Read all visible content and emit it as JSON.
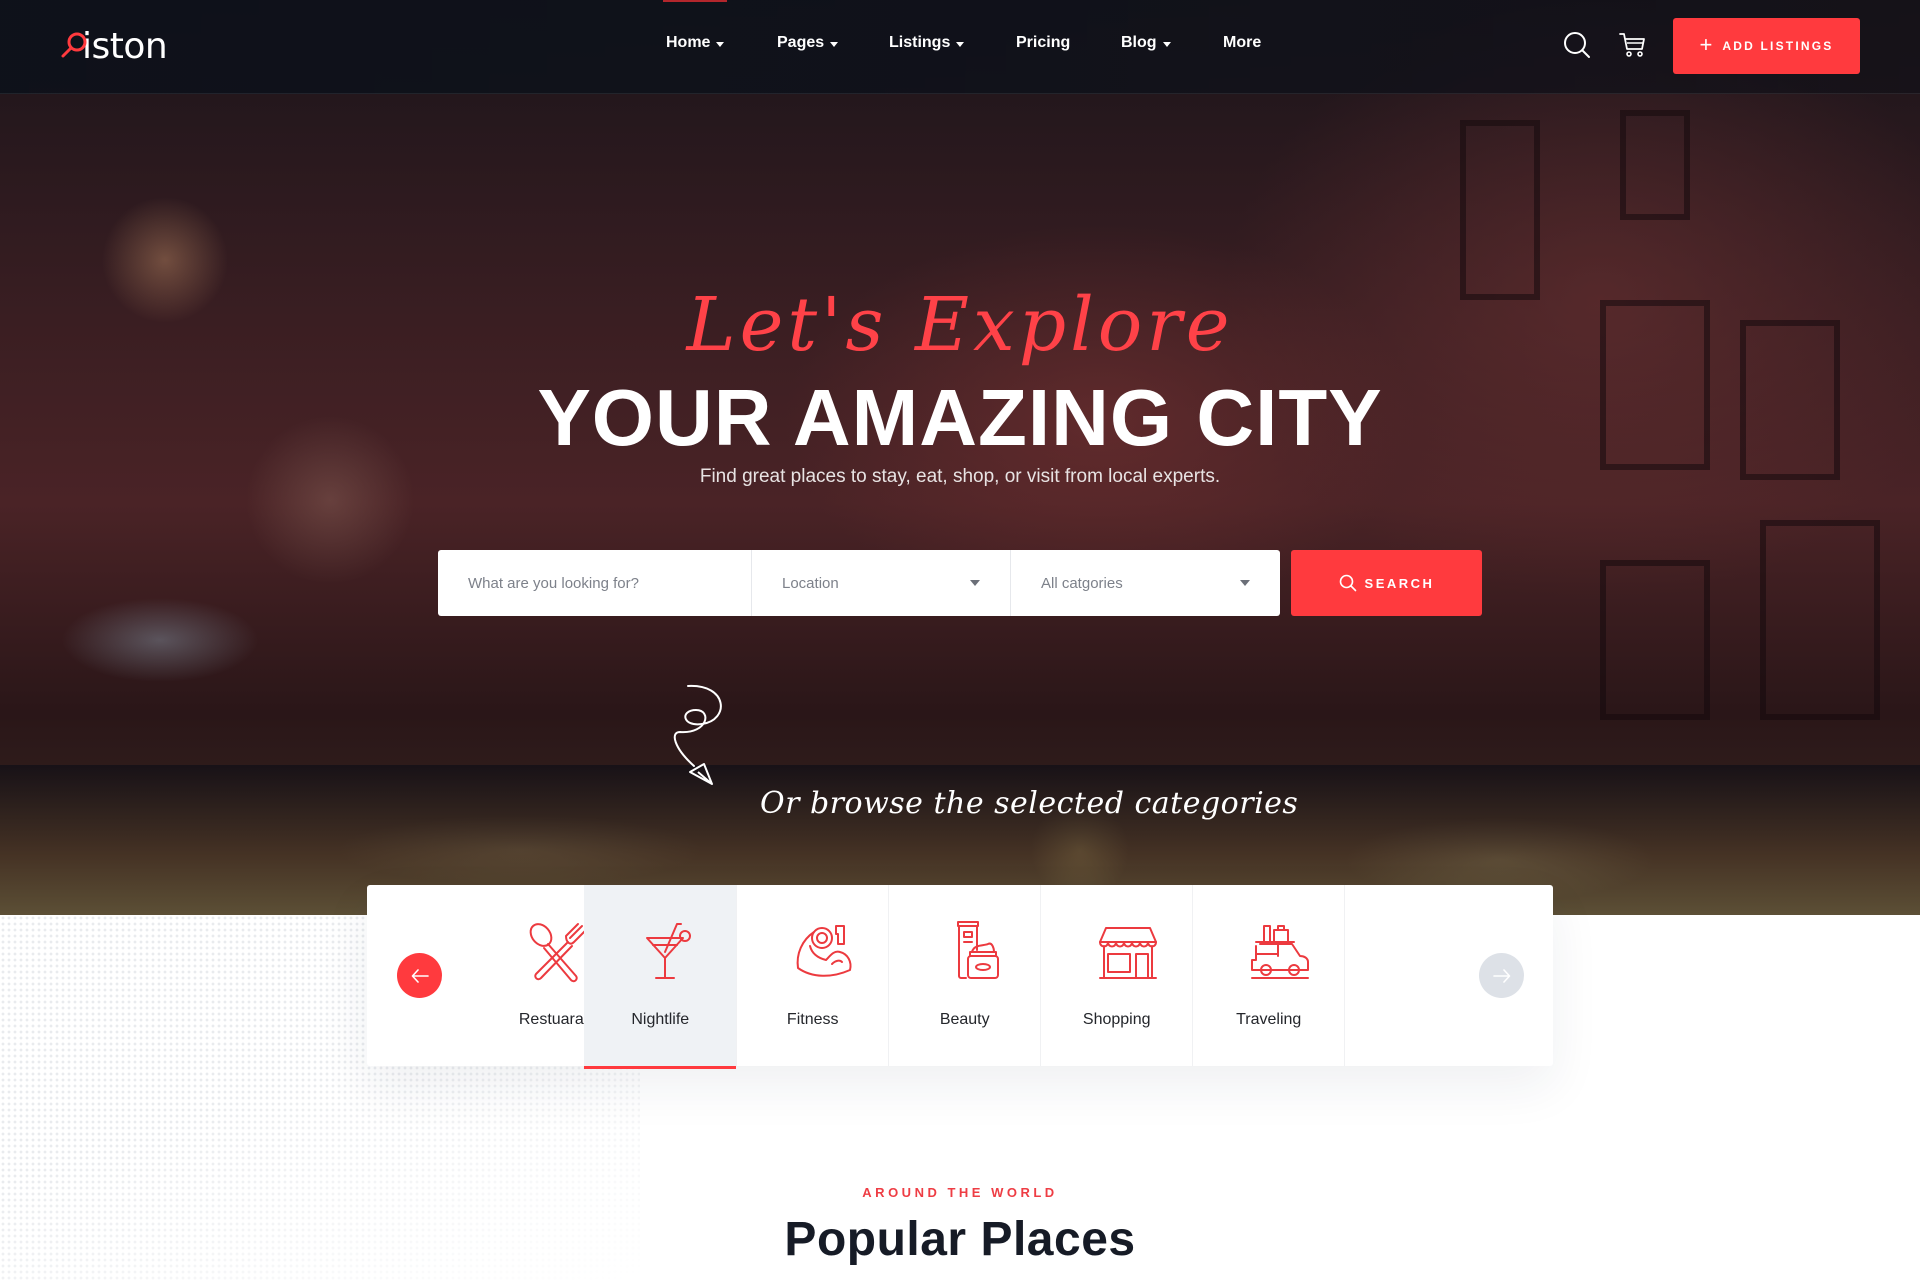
{
  "brand": {
    "name": "iston",
    "accent": "#ff3a3e",
    "dark": "#161b26"
  },
  "nav": {
    "items": [
      {
        "label": "Home",
        "dropdown": true,
        "active": true
      },
      {
        "label": "Pages",
        "dropdown": true
      },
      {
        "label": "Listings",
        "dropdown": true
      },
      {
        "label": "Pricing",
        "dropdown": false
      },
      {
        "label": "Blog",
        "dropdown": true
      },
      {
        "label": "More",
        "dropdown": false
      }
    ],
    "search_icon": "search-icon",
    "cart_icon": "cart-icon",
    "add_button": {
      "icon": "+",
      "label": "ADD LISTINGS"
    }
  },
  "hero": {
    "script_title": "Let's Explore",
    "title": "YOUR AMAZING CITY",
    "subtitle": "Find great places to stay, eat, shop, or visit from local experts.",
    "search": {
      "keyword_placeholder": "What are you looking for?",
      "location_value": "Location",
      "category_value": "All catgories",
      "button_label": "SEARCH"
    },
    "browse_text": "Or browse the selected categories"
  },
  "categories": {
    "items": [
      {
        "label": "Restuarant",
        "icon": "utensils-icon"
      },
      {
        "label": "Nightlife",
        "icon": "cocktail-icon",
        "active": true
      },
      {
        "label": "Fitness",
        "icon": "fitness-arm-icon"
      },
      {
        "label": "Beauty",
        "icon": "cosmetics-icon"
      },
      {
        "label": "Shopping",
        "icon": "storefront-icon"
      },
      {
        "label": "Traveling",
        "icon": "car-luggage-icon"
      }
    ],
    "prev_label": "←",
    "next_label": "→"
  },
  "section": {
    "eyebrow": "AROUND THE WORLD",
    "title": "Popular Places"
  }
}
